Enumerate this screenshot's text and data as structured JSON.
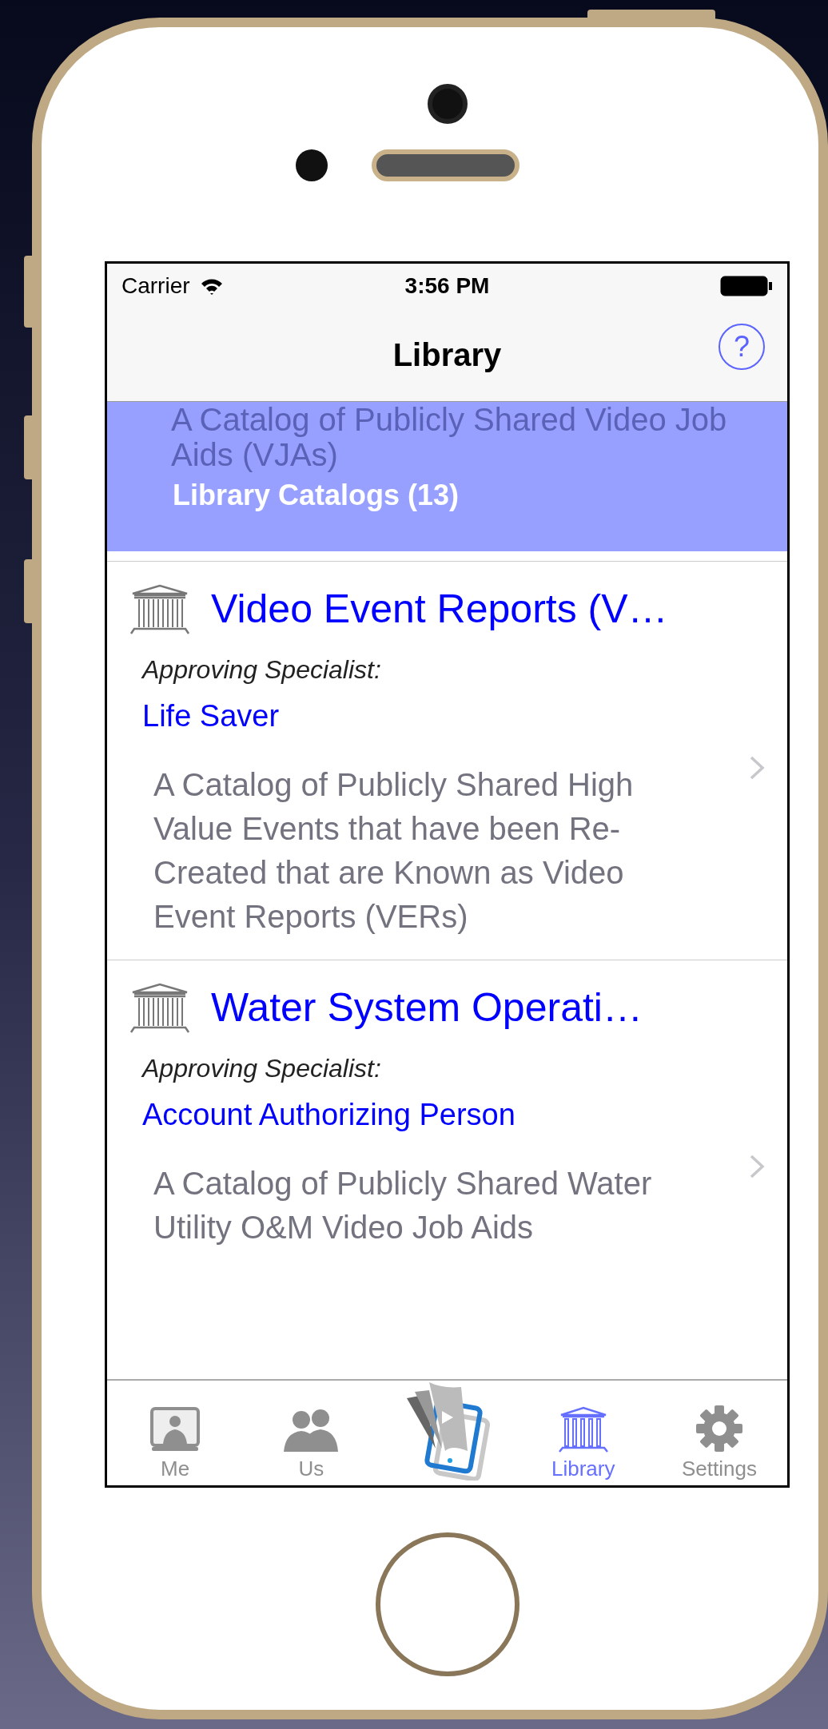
{
  "status_bar": {
    "carrier": "Carrier",
    "time": "3:56 PM"
  },
  "nav_bar": {
    "title": "Library",
    "help_button": "?"
  },
  "selected_header": {
    "description": "A Catalog of Publicly Shared Video Job Aids (VJAs)",
    "title": "Library Catalogs  (13)"
  },
  "catalogs": [
    {
      "title": "Video Event Reports (V…",
      "specialist_label": "Approving Specialist:",
      "specialist": "Life Saver",
      "description": "A Catalog of Publicly Shared High Value Events that have been Re-Created that are Known as Video Event Reports (VERs)"
    },
    {
      "title": "Water System Operati…",
      "specialist_label": "Approving Specialist:",
      "specialist": "Account Authorizing Person",
      "description": "A Catalog of Publicly Shared Water Utility O&M Video Job Aids"
    }
  ],
  "tab_bar": [
    {
      "kind": "me",
      "label": "Me",
      "selected": false
    },
    {
      "kind": "us",
      "label": "Us",
      "selected": false
    },
    {
      "kind": "video",
      "selected": false
    },
    {
      "kind": "library",
      "label": "Library",
      "selected": true
    },
    {
      "kind": "settings",
      "label": "Settings",
      "selected": false
    }
  ]
}
